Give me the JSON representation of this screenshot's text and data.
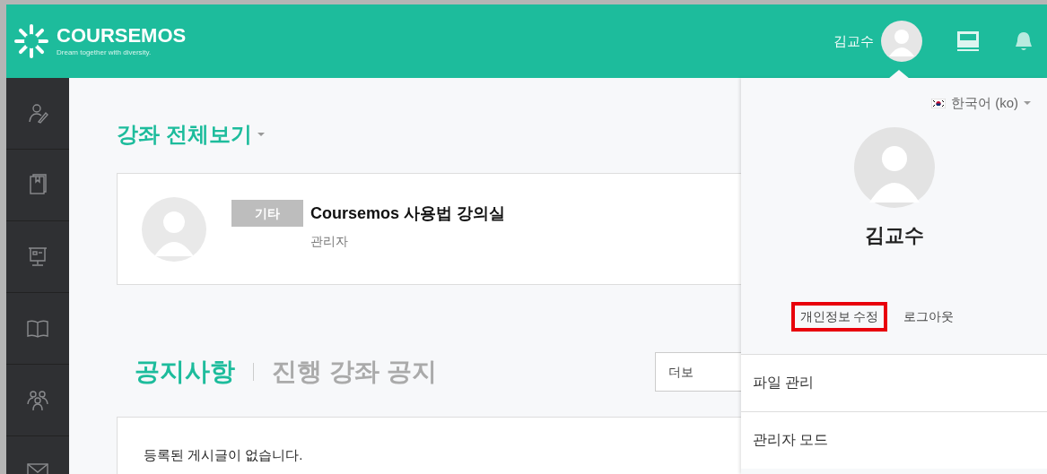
{
  "header": {
    "logo": {
      "name": "COURSEMOS",
      "tagline": "Dream together with diversity."
    },
    "user_name": "김교수"
  },
  "page_title": "강좌 전체보기",
  "course": {
    "category": "기타",
    "title": "Coursemos 사용법 강의실",
    "professor": "관리자"
  },
  "notice_tabs": [
    {
      "label": "공지사항",
      "selected": true
    },
    {
      "label": "진행 강좌 공지",
      "selected": false
    }
  ],
  "more_button": "더보",
  "notice_empty": "등록된 게시글이 없습니다.",
  "user_menu": {
    "open": true,
    "language": "한국어 (ko)",
    "name": "김교수",
    "links": [
      {
        "label": "개인정보 수정",
        "highlighted": true
      },
      {
        "label": "로그아웃",
        "highlighted": false
      }
    ],
    "items": [
      {
        "label": "파일 관리"
      },
      {
        "label": "관리자 모드"
      }
    ]
  }
}
